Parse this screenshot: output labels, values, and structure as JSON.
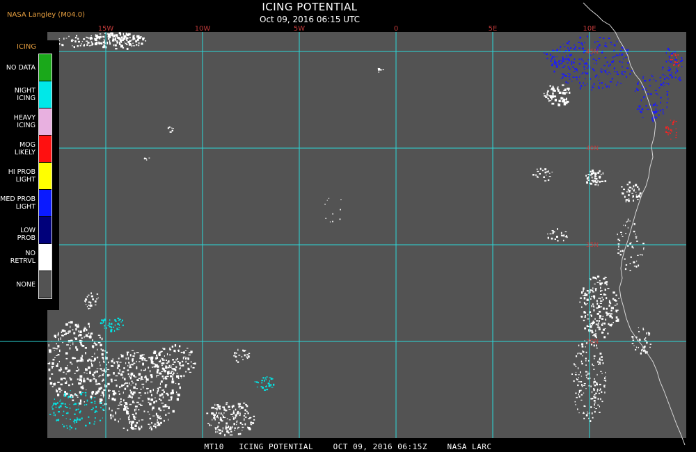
{
  "header": {
    "credit": "NASA Langley (M04.0)",
    "title": "ICING POTENTIAL",
    "datetime": "Oct 09, 2016 06:15 UTC"
  },
  "map": {
    "background_color": "#535353",
    "grid_color": "#2bd8d8",
    "label_color": "#c03a3a",
    "lon_labels": [
      "15W",
      "10W",
      "5W",
      "0",
      "5E",
      "10E"
    ],
    "lat_labels": [
      "45N",
      "40N",
      "35N",
      "30N"
    ]
  },
  "legend": {
    "title": "ICING",
    "items": [
      {
        "label": "NO DATA",
        "color": "#1aa81a"
      },
      {
        "label": "NIGHT ICING",
        "color": "#00e8e8"
      },
      {
        "label": "HEAVY ICING",
        "color": "#e8b0e0"
      },
      {
        "label": "MOG LIKELY",
        "color": "#ff1010"
      },
      {
        "label": "HI PROB LIGHT",
        "color": "#ffff00"
      },
      {
        "label": "MED PROB LIGHT",
        "color": "#0a1aff"
      },
      {
        "label": "LOW PROB",
        "color": "#00007a"
      },
      {
        "label": "NO RETRVL",
        "color": "#ffffff"
      },
      {
        "label": "NONE",
        "color": "#535353"
      }
    ]
  },
  "footer": {
    "text": "MT10   ICING POTENTIAL    OCT 09, 2016 06:15Z    NASA LARC"
  }
}
